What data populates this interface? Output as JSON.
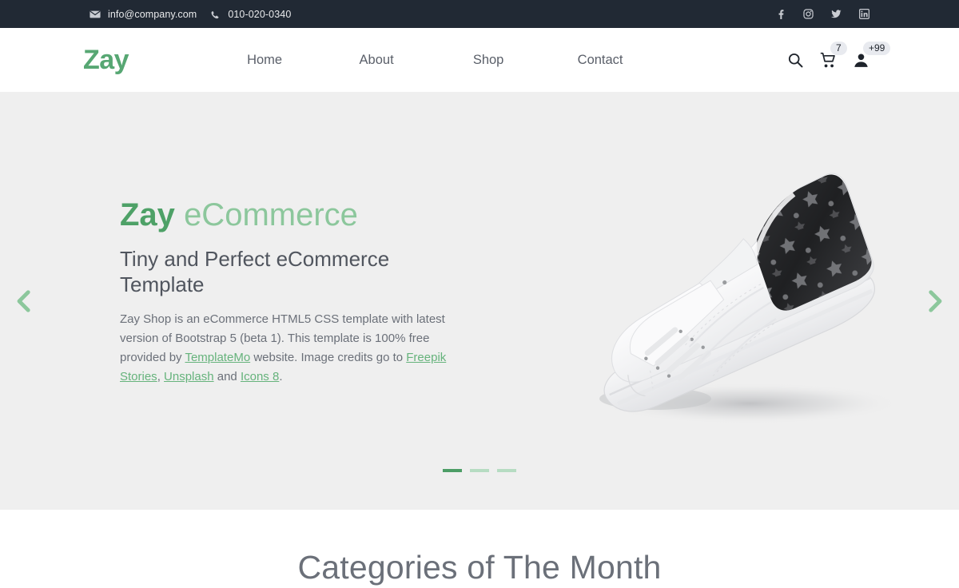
{
  "topbar": {
    "email": "info@company.com",
    "phone": "010-020-0340",
    "email_icon": "envelope-icon",
    "phone_icon": "phone-icon",
    "socials": [
      {
        "name": "facebook-icon",
        "label": "Facebook"
      },
      {
        "name": "instagram-icon",
        "label": "Instagram"
      },
      {
        "name": "twitter-icon",
        "label": "Twitter"
      },
      {
        "name": "linkedin-icon",
        "label": "LinkedIn"
      }
    ]
  },
  "navbar": {
    "logo": "Zay",
    "links": [
      {
        "label": "Home"
      },
      {
        "label": "About"
      },
      {
        "label": "Shop"
      },
      {
        "label": "Contact"
      }
    ],
    "search_icon": "search-icon",
    "cart_icon": "shopping-cart-icon",
    "cart_badge": "7",
    "account_icon": "user-account-icon",
    "account_badge": "+99"
  },
  "hero": {
    "title_bold": "Zay",
    "title_light": "eCommerce",
    "subtitle": "Tiny and Perfect eCommerce Template",
    "paragraph": {
      "p1": "Zay Shop is an eCommerce HTML5 CSS template with latest version of Bootstrap 5 (beta 1). This template is 100% free provided by ",
      "link1": "TemplateMo",
      "p2": " website. Image credits go to ",
      "link2": "Freepik Stories",
      "p3": ", ",
      "link3": "Unsplash",
      "p4": " and ",
      "link4": "Icons 8",
      "p5": "."
    },
    "image_alt": "white-sneaker-product-image",
    "prev_arrow": "carousel-prev-icon",
    "next_arrow": "carousel-next-icon",
    "indicators": [
      {
        "active": true
      },
      {
        "active": false
      },
      {
        "active": false
      }
    ]
  },
  "categories": {
    "heading": "Categories of The Month"
  },
  "colors": {
    "topbar_bg": "#212934",
    "brand_green": "#57a773",
    "brand_green_light": "#8cc79c",
    "hero_bg": "#efefef",
    "text_gray": "#6b7079"
  }
}
